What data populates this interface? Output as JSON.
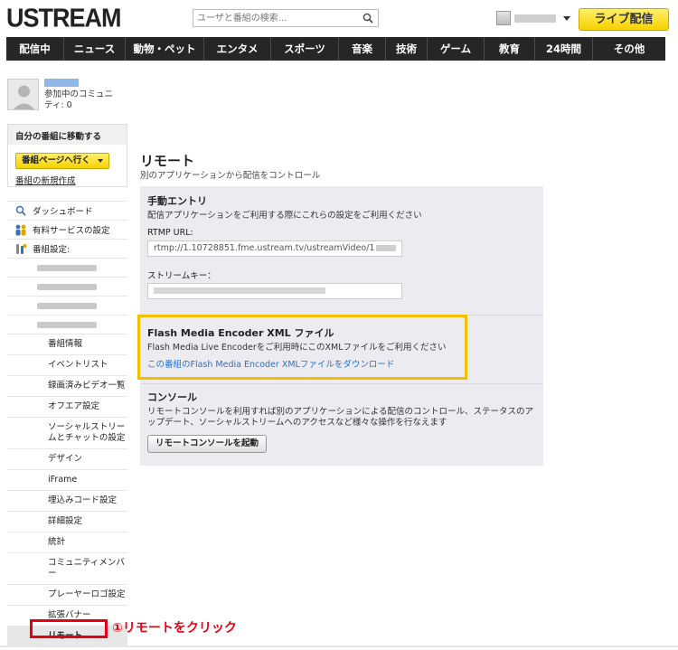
{
  "header": {
    "logo": "USTREAM",
    "search_placeholder": "ユーザと番組の検索...",
    "live_button": "ライブ配信"
  },
  "nav": [
    "配信中",
    "ニュース",
    "動物・ペット",
    "エンタメ",
    "スポーツ",
    "音楽",
    "技術",
    "ゲーム",
    "教育",
    "24時間",
    "その他"
  ],
  "profile": {
    "community": "参加中のコミュニティ: 0"
  },
  "program": {
    "heading": "自分の番組に移動する",
    "goto_button": "番組ページへ行く",
    "new_link": "番組の新規作成"
  },
  "sidebar": {
    "dashboard": "ダッシュボード",
    "paid": "有料サービスの設定",
    "settings": "番組設定:",
    "sub": [
      "番組情報",
      "イベントリスト",
      "録画済みビデオ一覧",
      "オフエア設定",
      "ソーシャルストリームとチャットの設定",
      "デザイン",
      "iFrame",
      "埋込みコード設定",
      "詳細設定",
      "統計",
      "コミュニティメンバー",
      "プレーヤーロゴ設定",
      "拡張バナー",
      "リモート"
    ]
  },
  "main": {
    "title": "リモート",
    "subtitle": "別のアプリケーションから配信をコントロール",
    "manual": {
      "heading": "手動エントリ",
      "desc": "配信アプリケーションをご利用する際にこれらの設定をご利用ください",
      "rtmp_label": "RTMP URL:",
      "rtmp_value": "rtmp://1.10728851.fme.ustream.tv/ustreamVideo/1",
      "key_label": "ストリームキー："
    },
    "fme": {
      "heading": "Flash Media Encoder XML ファイル",
      "desc": "Flash Media Live Encoderをご利用時にこのXMLファイルをご利用ください",
      "link": "この番組のFlash Media Encoder XMLファイルをダウンロード"
    },
    "console": {
      "heading": "コンソール",
      "desc": "リモートコンソールを利用すれば別のアプリケーションによる配信のコントロール、ステータスのアップデート、ソーシャルストリームへのアクセスなど様々な操作を行なえます",
      "button": "リモートコンソールを起動"
    }
  },
  "callout": "①リモートをクリック",
  "colors": {
    "accent_yellow": "#f6d200",
    "nav_bg": "#262626",
    "highlight_red": "#e60012",
    "highlight_yellow": "#f3c000",
    "link_blue": "#2a6fc9"
  }
}
